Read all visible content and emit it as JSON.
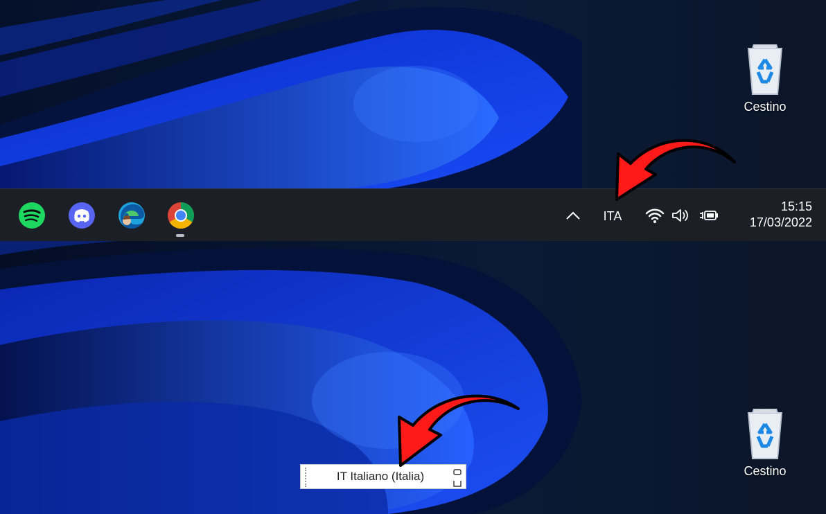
{
  "desktop": {
    "recycle_bin_label": "Cestino",
    "icon": "recycle-bin-icon"
  },
  "taskbar": {
    "apps": [
      {
        "name": "Spotify",
        "icon": "spotify-icon",
        "color": "#1ed760"
      },
      {
        "name": "Discord",
        "icon": "discord-icon",
        "color": "#5865f2"
      },
      {
        "name": "Microsoft Edge",
        "icon": "edge-icon",
        "color": "#1fa3dc"
      },
      {
        "name": "Google Chrome",
        "icon": "chrome-icon",
        "color": "#4285f4",
        "running": true
      }
    ],
    "tray": {
      "overflow_icon": "chevron-up-icon",
      "language": "ITA",
      "icons": [
        "wifi-icon",
        "volume-icon",
        "battery-charging-icon"
      ]
    },
    "clock": {
      "time": "15:15",
      "date": "17/03/2022"
    }
  },
  "language_bar": {
    "label": "IT  Italiano (Italia)"
  },
  "annotations": {
    "arrow_color": "#ff1a1a"
  }
}
